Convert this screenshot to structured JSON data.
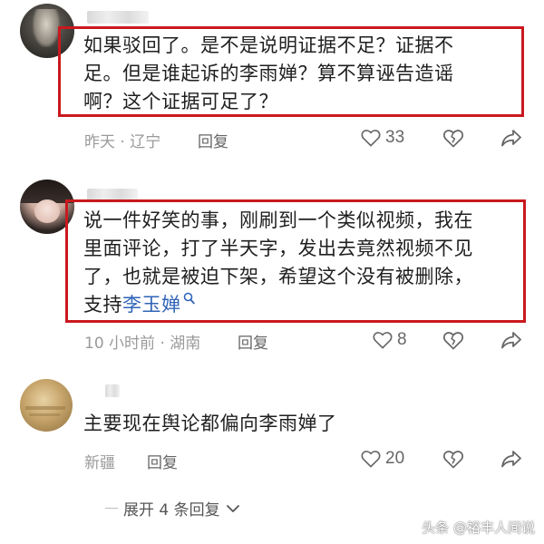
{
  "comments": [
    {
      "lines": [
        "如果驳回了。是不是说明证据不足？证据不",
        "足。但是谁起诉的李雨婵？算不算诬告造谣",
        "啊？这个证据可足了？"
      ],
      "time_location": "昨天 · 辽宁",
      "reply_label": "回复",
      "likes": "33"
    },
    {
      "lines": [
        "说一件好笑的事，刚刷到一个类似视频，我在",
        "里面评论，打了半天字，发出去竟然视频不见",
        "了，也就是被迫下架，希望这个没有被删除，"
      ],
      "last_line_prefix": "支持",
      "link_text": "李玉婵",
      "time_location": "10 小时前 · 湖南",
      "reply_label": "回复",
      "likes": "8"
    },
    {
      "lines": [
        "主要现在舆论都偏向李雨婵了"
      ],
      "time_location": "新疆",
      "reply_label": "回复",
      "likes": "20"
    }
  ],
  "expand_label": "展开 4 条回复",
  "watermark": "头条 @裕丰人间说",
  "colors": {
    "highlight_border": "#c9191e",
    "link": "#2f63b8",
    "meta_text": "#9a9a9a"
  },
  "icons": [
    "heart-icon",
    "dislike-heart-icon",
    "share-icon",
    "search-icon",
    "chevron-down-icon"
  ]
}
